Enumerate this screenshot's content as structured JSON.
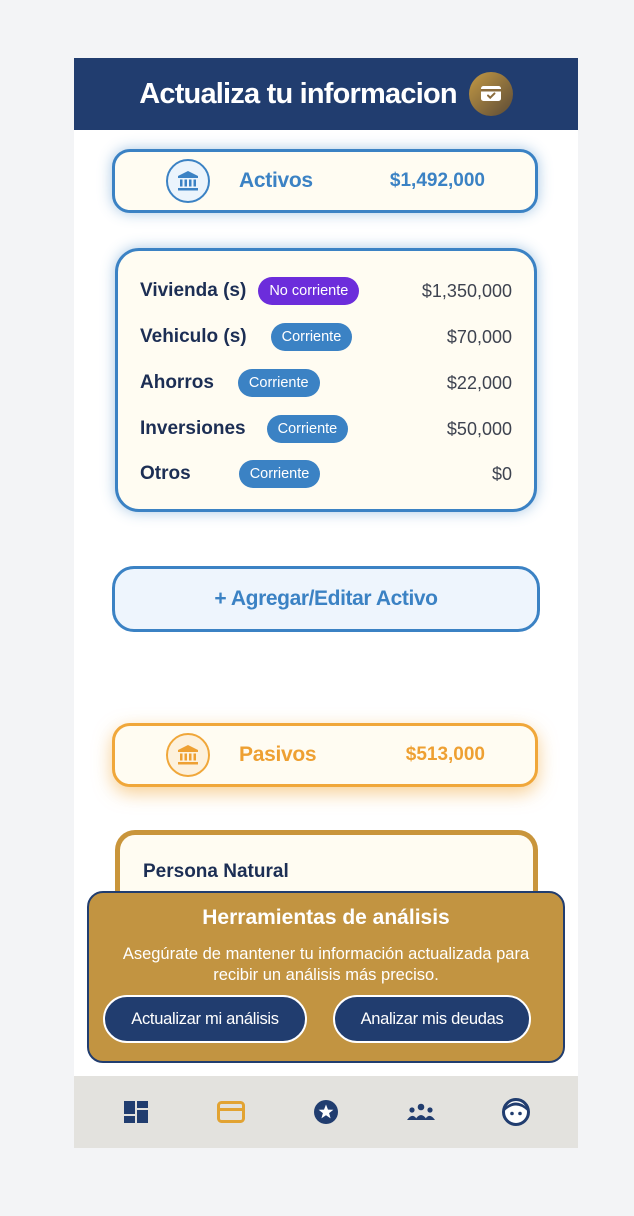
{
  "header": {
    "title": "Actualiza tu informacion"
  },
  "activos": {
    "title": "Activos",
    "total": "$1,492,000",
    "items": [
      {
        "name": "Vivienda (s)",
        "badge": "No corriente",
        "amount": "$1,350,000"
      },
      {
        "name": "Vehiculo (s)",
        "badge": "Corriente",
        "amount": "$70,000"
      },
      {
        "name": "Ahorros",
        "badge": "Corriente",
        "amount": "$22,000"
      },
      {
        "name": "Inversiones",
        "badge": "Corriente",
        "amount": "$50,000"
      },
      {
        "name": "Otros",
        "badge": "Corriente",
        "amount": "$0"
      }
    ],
    "add_button": "+ Agregar/Editar Activo"
  },
  "pasivos": {
    "title": "Pasivos",
    "total": "$513,000",
    "list_title": "Persona Natural"
  },
  "tools": {
    "title": "Herramientas de análisis",
    "description": "Asegúrate de mantener tu información actualizada para recibir un análisis más preciso.",
    "button_update": "Actualizar mi análisis",
    "button_debts": "Analizar mis deudas"
  },
  "nav": {
    "items": [
      {
        "icon": "dashboard-icon",
        "active": false
      },
      {
        "icon": "card-icon",
        "active": true
      },
      {
        "icon": "star-icon",
        "active": false
      },
      {
        "icon": "group-icon",
        "active": false
      },
      {
        "icon": "profile-icon",
        "active": false
      }
    ],
    "active_color": "#e2a332",
    "inactive_color": "#213d6f"
  },
  "colors": {
    "navy": "#213d6f",
    "blue": "#3b82c4",
    "orange": "#f0a73a",
    "gold": "#c29441",
    "purple": "#6c2ddb"
  }
}
